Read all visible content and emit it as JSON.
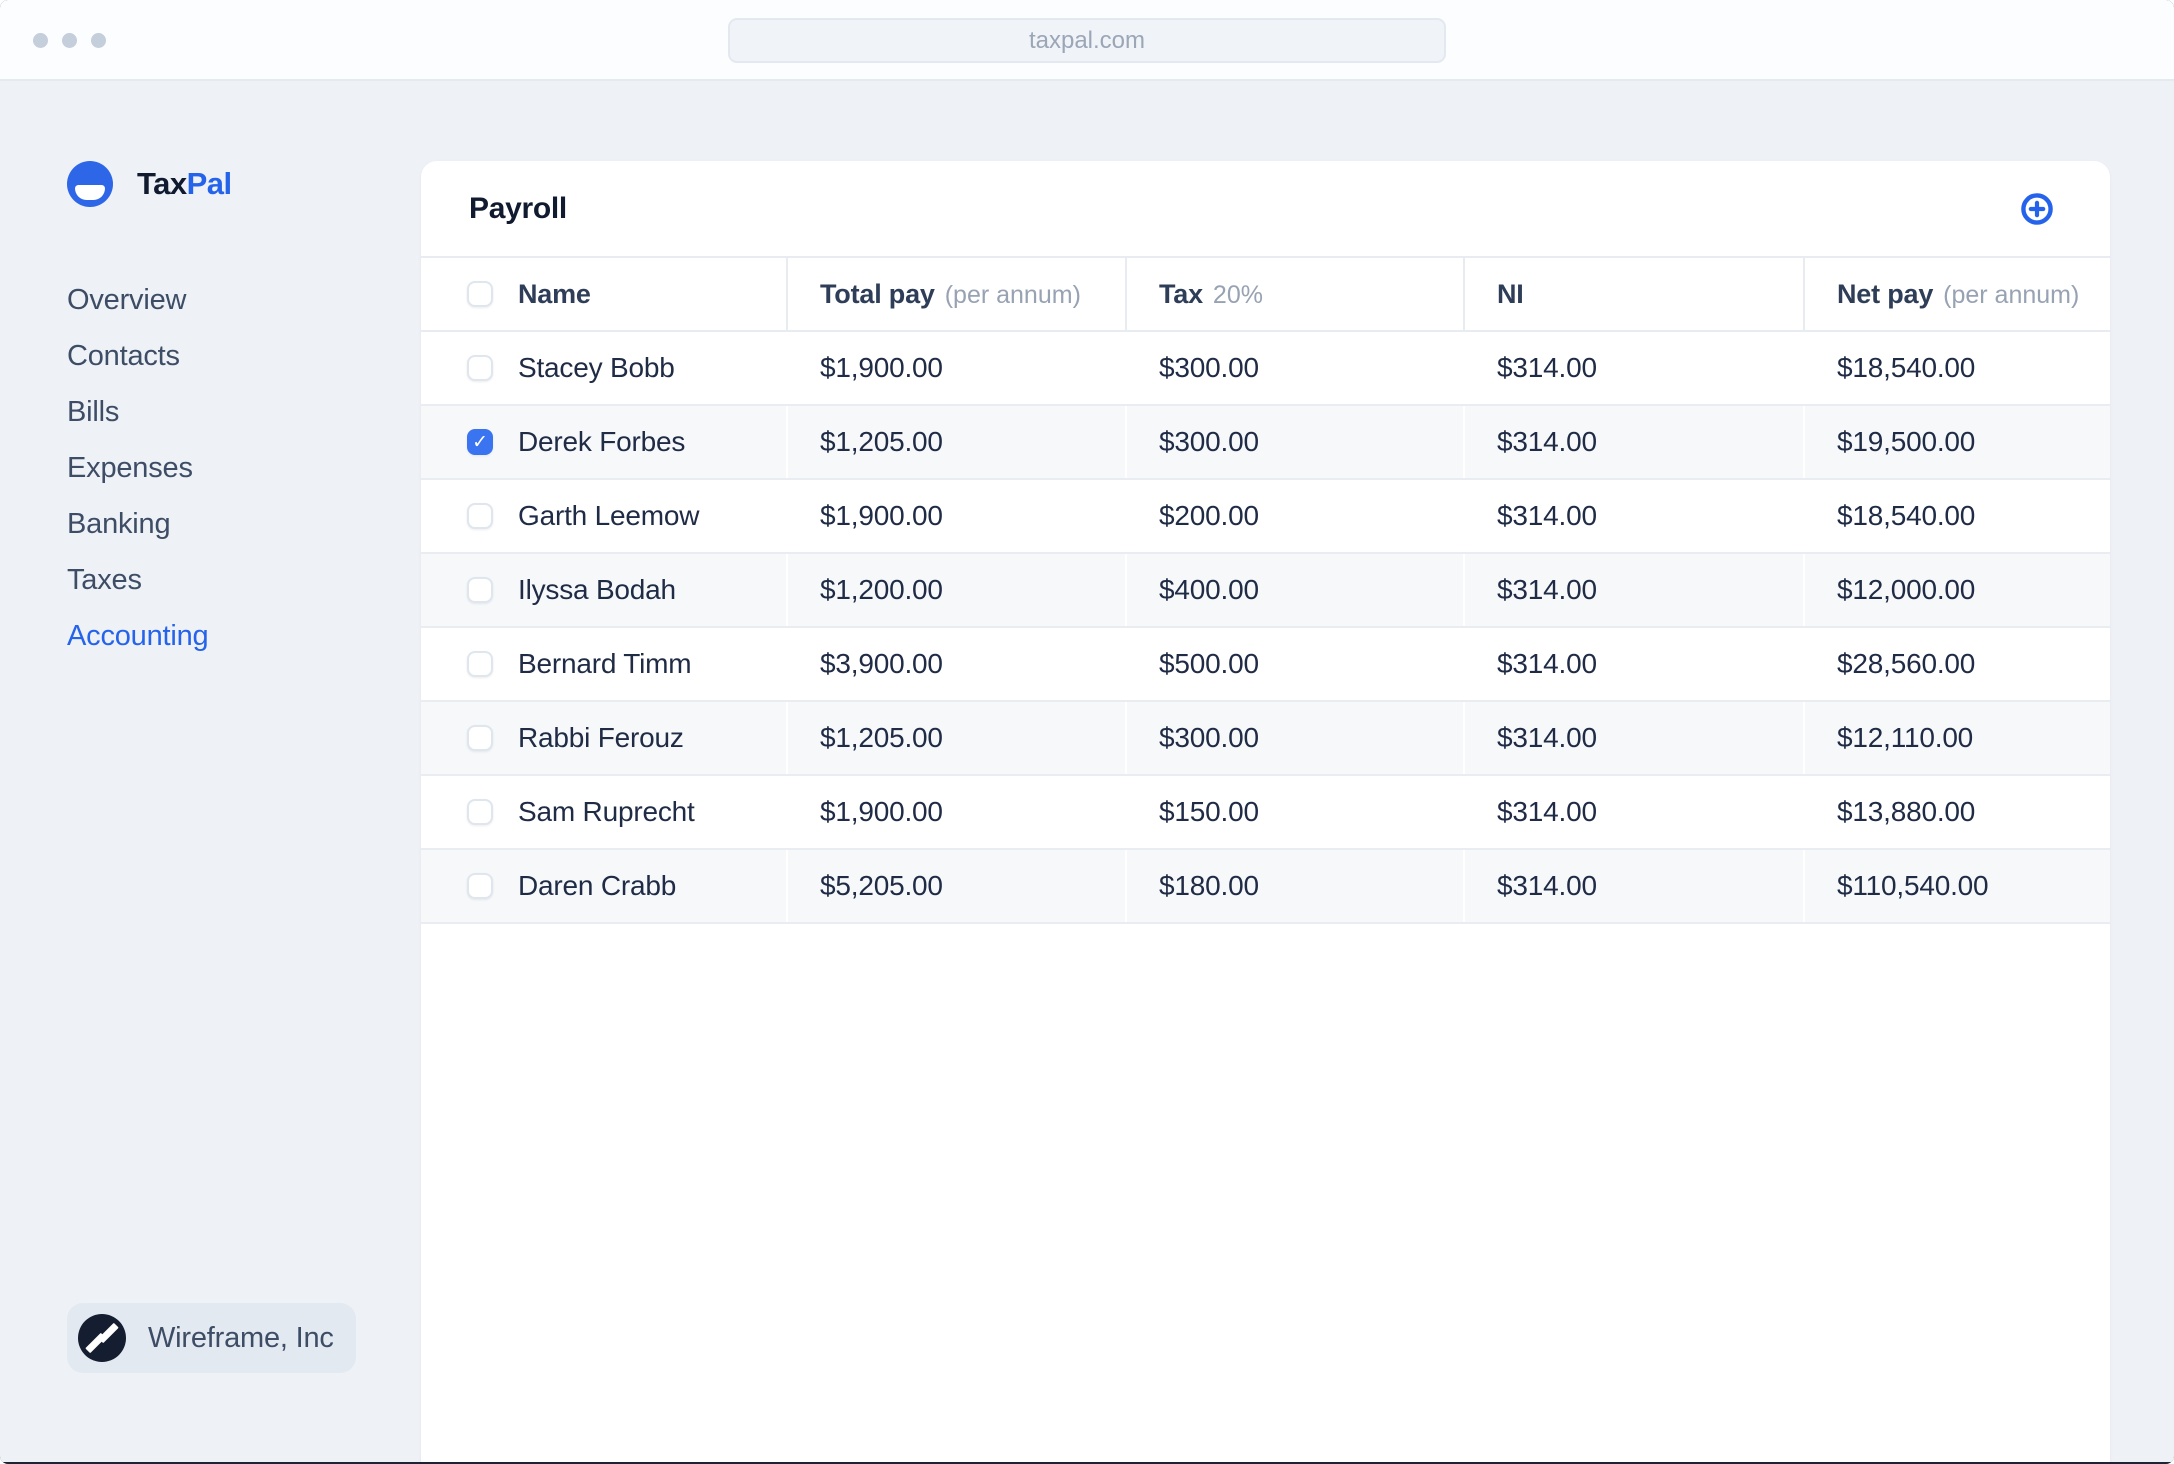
{
  "browser": {
    "url": "taxpal.com"
  },
  "brand": {
    "name_primary": "Tax",
    "name_secondary": "Pal"
  },
  "sidebar": {
    "items": [
      {
        "label": "Overview",
        "active": false
      },
      {
        "label": "Contacts",
        "active": false
      },
      {
        "label": "Bills",
        "active": false
      },
      {
        "label": "Expenses",
        "active": false
      },
      {
        "label": "Banking",
        "active": false
      },
      {
        "label": "Taxes",
        "active": false
      },
      {
        "label": "Accounting",
        "active": true
      }
    ],
    "footer": {
      "company": "Wireframe, Inc"
    }
  },
  "payroll": {
    "title": "Payroll",
    "add_button_icon": "plus-circle-icon",
    "columns": [
      {
        "label": "Name",
        "suffix": ""
      },
      {
        "label": "Total pay",
        "suffix": "(per annum)"
      },
      {
        "label": "Tax",
        "suffix": "20%"
      },
      {
        "label": "NI",
        "suffix": ""
      },
      {
        "label": "Net pay",
        "suffix": "(per annum)"
      }
    ],
    "rows": [
      {
        "name": "Stacey Bobb",
        "checked": false,
        "total_pay": "$1,900.00",
        "tax": "$300.00",
        "ni": "$314.00",
        "net_pay": "$18,540.00"
      },
      {
        "name": "Derek Forbes",
        "checked": true,
        "total_pay": "$1,205.00",
        "tax": "$300.00",
        "ni": "$314.00",
        "net_pay": "$19,500.00"
      },
      {
        "name": "Garth Leemow",
        "checked": false,
        "total_pay": "$1,900.00",
        "tax": "$200.00",
        "ni": "$314.00",
        "net_pay": "$18,540.00"
      },
      {
        "name": "Ilyssa Bodah",
        "checked": false,
        "total_pay": "$1,200.00",
        "tax": "$400.00",
        "ni": "$314.00",
        "net_pay": "$12,000.00"
      },
      {
        "name": "Bernard Timm",
        "checked": false,
        "total_pay": "$3,900.00",
        "tax": "$500.00",
        "ni": "$314.00",
        "net_pay": "$28,560.00"
      },
      {
        "name": "Rabbi Ferouz",
        "checked": false,
        "total_pay": "$1,205.00",
        "tax": "$300.00",
        "ni": "$314.00",
        "net_pay": "$12,110.00"
      },
      {
        "name": "Sam Ruprecht",
        "checked": false,
        "total_pay": "$1,900.00",
        "tax": "$150.00",
        "ni": "$314.00",
        "net_pay": "$13,880.00"
      },
      {
        "name": "Daren Crabb",
        "checked": false,
        "total_pay": "$5,205.00",
        "tax": "$180.00",
        "ni": "$314.00",
        "net_pay": "$110,540.00"
      }
    ]
  },
  "colors": {
    "accent_blue": "#2563eb",
    "checkbox_blue": "#3b74f0",
    "page_bg": "#eef1f6",
    "card_bg": "#ffffff",
    "stripe_bg": "#f6f8fa",
    "border": "#e8ecf1",
    "text_dark": "#101b30",
    "text_muted": "#97a2b3",
    "org_logo_bg": "#141e30"
  }
}
